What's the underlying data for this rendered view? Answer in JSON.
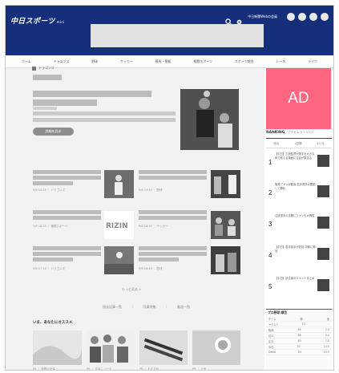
{
  "header": {
    "logo_text": "中日スポーツ",
    "logo_badge": "mini",
    "search_icon": "search-icon",
    "settings_icon": "gear-icon",
    "link": "中日新聞Webの会員",
    "social": [
      "facebook-icon",
      "twitter-icon",
      "line-icon",
      "instagram-icon"
    ]
  },
  "nav": {
    "items": [
      "ホーム",
      "ドラゴンズ",
      "野球",
      "サッカー",
      "競馬・競艇",
      "格闘スポーツ",
      "スポーツ総合",
      "レース",
      "ライフ"
    ]
  },
  "breadcrumb": {
    "text": "ドラゴンズ"
  },
  "article": {
    "button_label": "詳細を見る"
  },
  "feed": {
    "more_label": "もっと見る ∨",
    "links": "過去記事一覧 ｜ 写真特集 ｜ 動画一覧"
  },
  "recommend": {
    "title": "いま、あなたにオススメ"
  },
  "sidebar": {
    "ad_label": "AD",
    "ranking_title": "RANKING",
    "ranking_sub": "アクセス ランキング",
    "tabs": [
      "総合",
      "1週間",
      "1ヶ月"
    ],
    "items": [
      {
        "num": "1",
        "text": "【中日】立浪監督が選手を大きな声で称える場面に注目が集まる"
      },
      {
        "num": "2",
        "text": "阪神ファンが歓喜 若手選手が躍動して勝利"
      },
      {
        "num": "3",
        "text": "注目選手の活躍にファンも大興奮"
      },
      {
        "num": "4",
        "text": "【中日】若手投手が好投 次戦に期待"
      },
      {
        "num": "5",
        "text": "【中日】試合後のコメントまとめ"
      }
    ],
    "table_title": "プロ野球 順位",
    "table_rows": [
      [
        "チーム",
        "勝",
        "差"
      ],
      [
        "ヤクルト",
        "73",
        "-"
      ],
      [
        "阪神",
        "69",
        "2.5"
      ],
      [
        "巨人",
        "66",
        "5.0"
      ],
      [
        "広島",
        "63",
        "7.5"
      ],
      [
        "中日",
        "55",
        "14.0"
      ],
      [
        "DeNA",
        "54",
        "15.5"
      ]
    ]
  }
}
